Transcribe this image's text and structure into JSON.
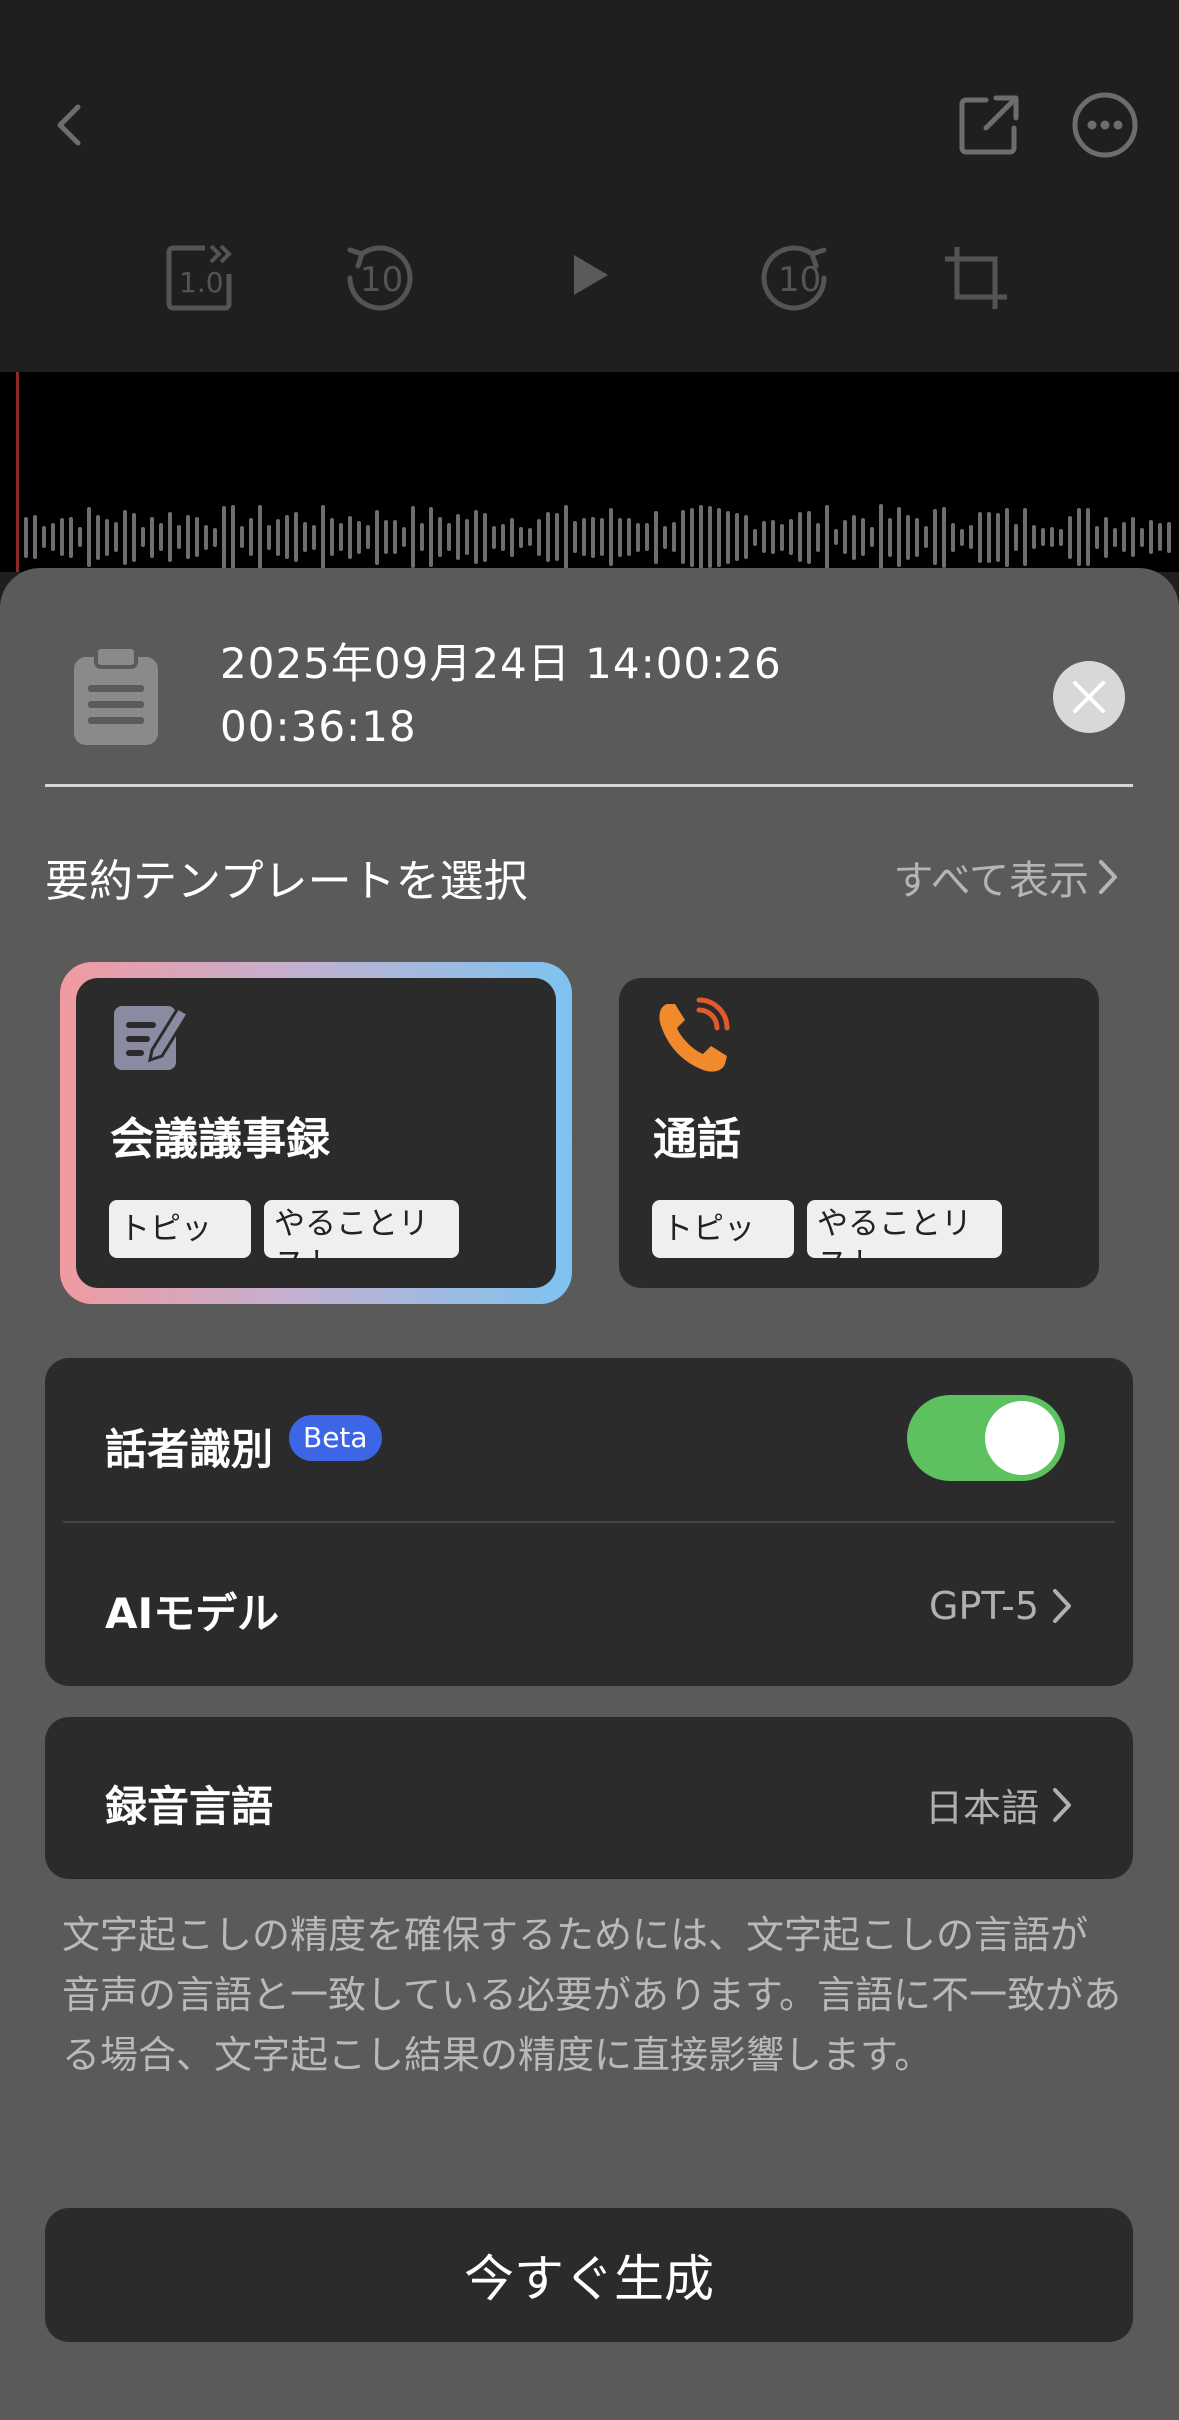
{
  "toolbar": {
    "back_icon": "chevron-left-icon",
    "share_icon": "share-icon",
    "more_icon": "more-icon",
    "speed_label": "1.0",
    "rewind_label": "10",
    "forward_label": "10"
  },
  "recording": {
    "title": "2025年09月24日 14:00:26",
    "duration": "00:36:18"
  },
  "templates": {
    "section_label": "要約テンプレートを選択",
    "show_all": "すべて表示",
    "items": [
      {
        "title": "会議議事録",
        "chips": [
          "トピック",
          "やることリスト"
        ],
        "selected": true
      },
      {
        "title": "通話",
        "chips": [
          "トピック",
          "やることリスト"
        ],
        "selected": false
      }
    ]
  },
  "settings": {
    "speaker_label": "話者識別",
    "beta": "Beta",
    "speaker_enabled": true,
    "ai_model_label": "AIモデル",
    "ai_model_value": "GPT-5",
    "language_label": "録音言語",
    "language_value": "日本語"
  },
  "note": "文字起こしの精度を確保するためには、文字起こしの言語が音声の言語と一致している必要があります。言語に不一致がある場合、文字起こし結果の精度に直接影響します。",
  "generate_button": "今すぐ生成",
  "colors": {
    "toggle_on": "#5ec160",
    "beta_badge": "#3c66e6",
    "phone_icon": "#f08a2c"
  }
}
